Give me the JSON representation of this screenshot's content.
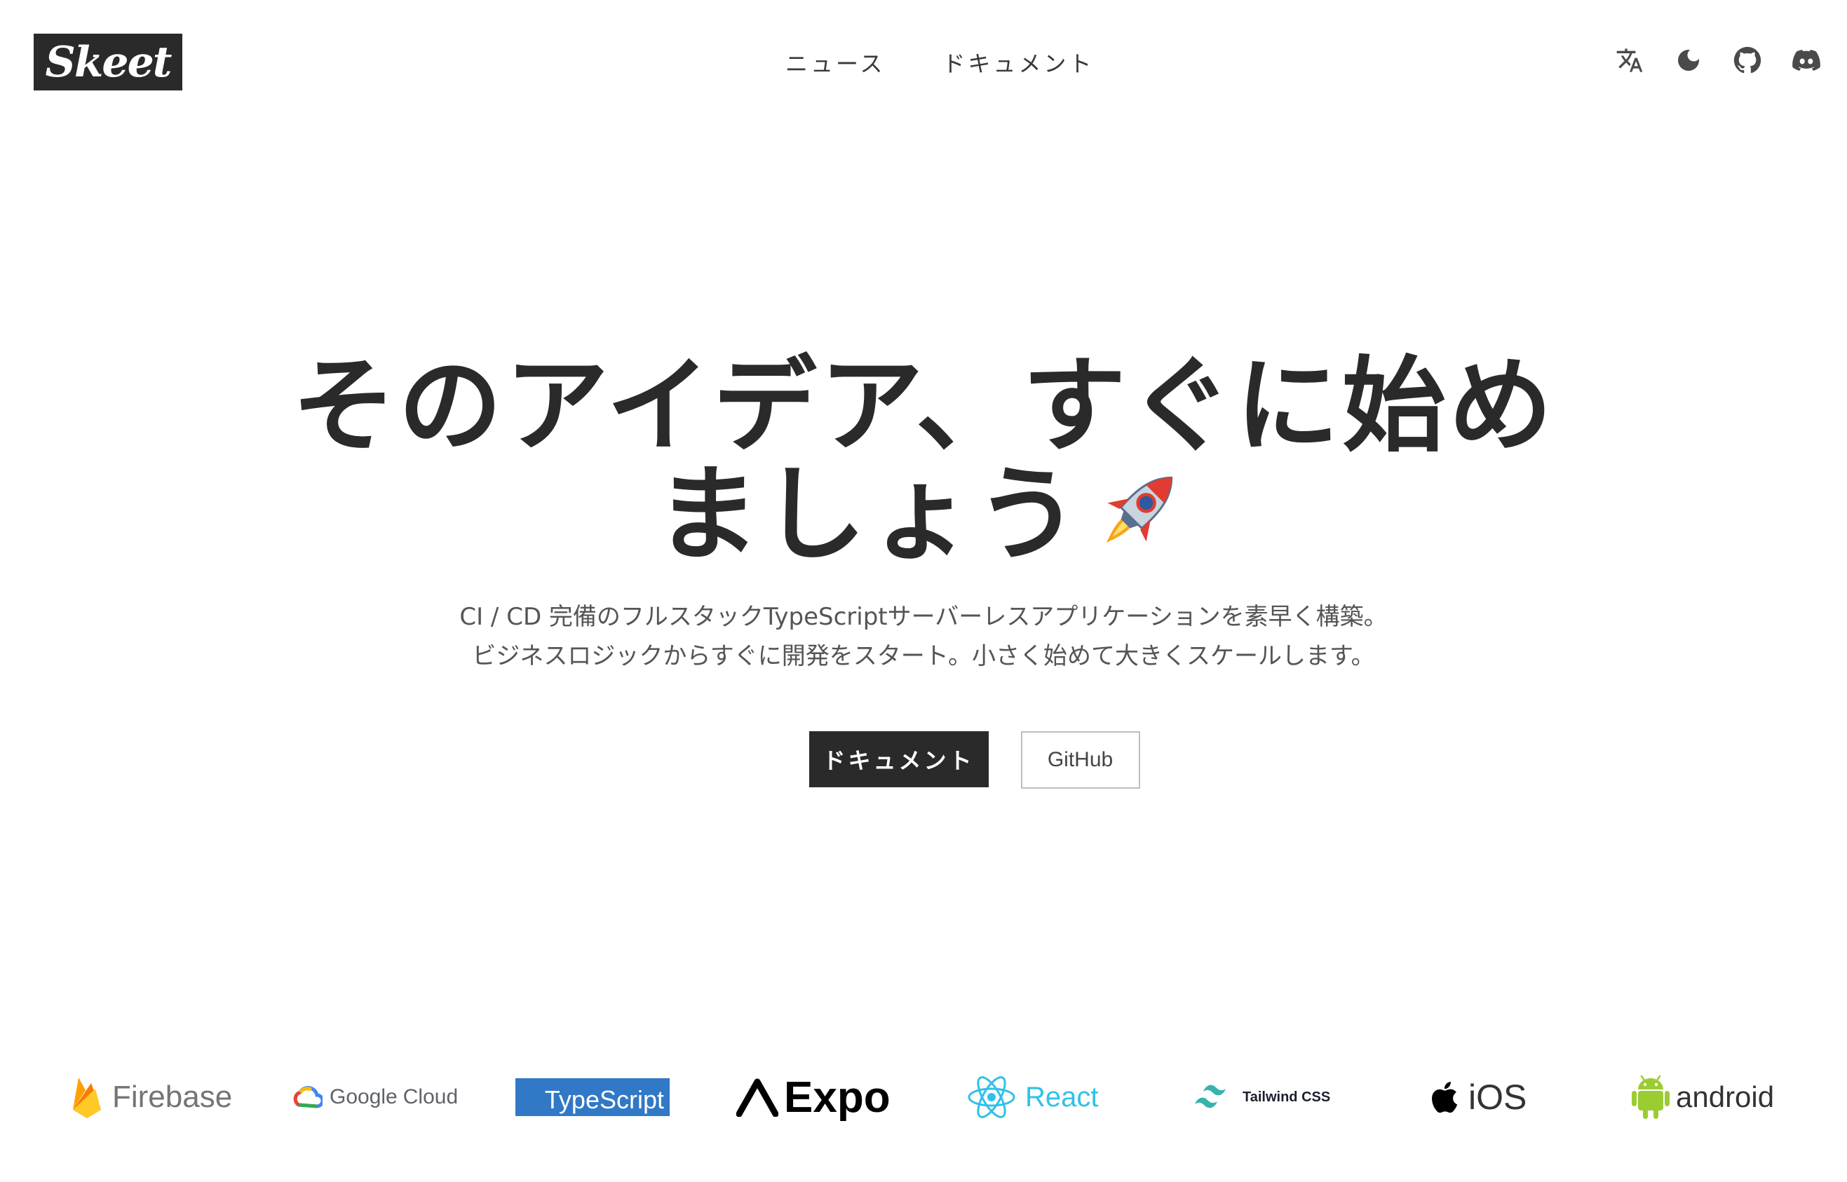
{
  "header": {
    "logo": "Skeet",
    "nav": [
      "ニュース",
      "ドキュメント"
    ],
    "tools": [
      "translate-icon",
      "moon-icon",
      "github-icon",
      "discord-icon"
    ]
  },
  "hero": {
    "title_line1": "そのアイデア、すぐに始め",
    "title_line2": "ましょう",
    "subtitle_line1": "CI / CD 完備のフルスタックTypeScriptサーバーレスアプリケーションを素早く構築。",
    "subtitle_line2": "ビジネスロジックからすぐに開発をスタート。小さく始めて大きくスケールします。"
  },
  "buttons": {
    "primary": "ドキュメント",
    "secondary": "GitHub"
  },
  "tech_logos": {
    "firebase": "Firebase",
    "gcloud_google": "Google",
    "gcloud_cloud": "Cloud",
    "typescript": "TypeScript",
    "expo": "Expo",
    "react": "React",
    "tailwind": "Tailwind CSS",
    "ios": "iOS",
    "android": "android"
  },
  "colors": {
    "text": "#2b2a2b",
    "react": "#2fc1e8",
    "typescript": "#3178c6",
    "tailwind": "#38b2ac",
    "android": "#9acd32"
  }
}
